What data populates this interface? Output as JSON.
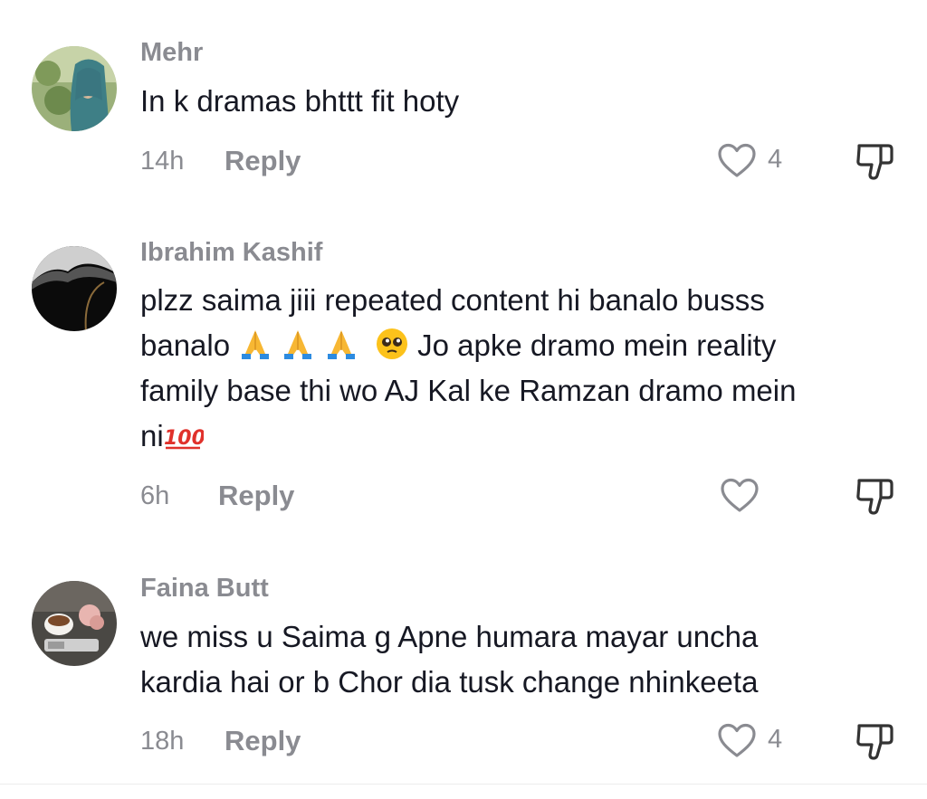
{
  "comments": [
    {
      "username": "Mehr",
      "lines": [
        "In k dramas bhttt fit hoty"
      ],
      "time": "14h",
      "reply_label": "Reply",
      "like_count": "4",
      "avatar": "avatar-woman-hijab"
    },
    {
      "username": "Ibrahim Kashif",
      "lines": [
        "plzz saima jiii repeated content hi banalo busss",
        "banalo",
        "Jo apke dramo mein reality",
        "family base thi wo AJ Kal ke Ramzan dramo mein",
        "ni"
      ],
      "emojis": [
        "folded-hands-emoji",
        "folded-hands-emoji",
        "folded-hands-emoji",
        "pleading-face-emoji",
        "hundred-points-emoji"
      ],
      "time": "6h",
      "reply_label": "Reply",
      "like_count": "",
      "avatar": "avatar-dark-landscape"
    },
    {
      "username": "Faina Butt",
      "lines": [
        "we miss u Saima g Apne humara mayar uncha",
        "kardia hai or b Chor dia tusk change nhinkeeta"
      ],
      "time": "18h",
      "reply_label": "Reply",
      "like_count": "4",
      "avatar": "avatar-desk-cup"
    }
  ],
  "icons": {
    "like": "heart-outline-icon",
    "dislike": "thumbs-down-icon"
  },
  "colors": {
    "text": "#161823",
    "muted": "#8a8b91"
  }
}
